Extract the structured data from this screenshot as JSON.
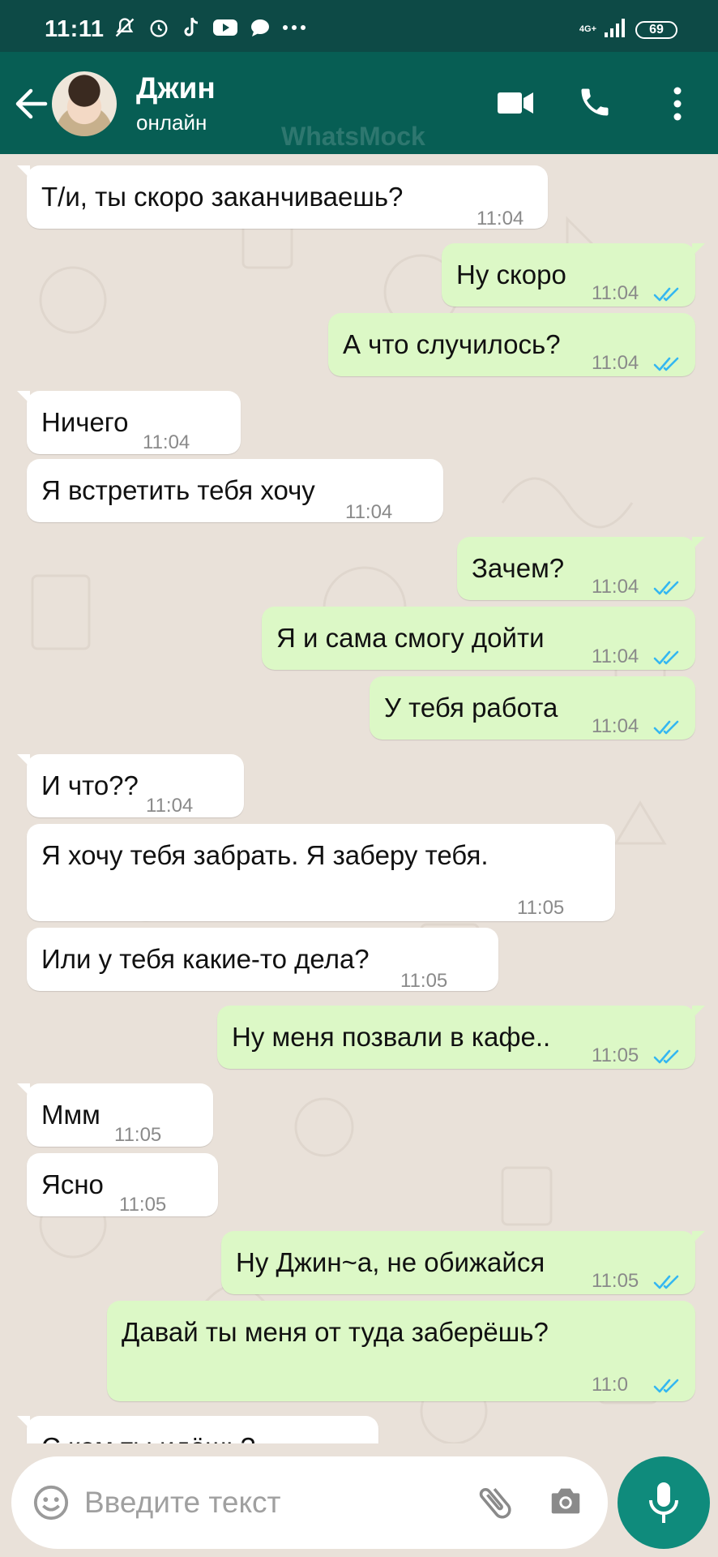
{
  "status_bar": {
    "time": "11:11",
    "network": "4G+",
    "battery": "69"
  },
  "header": {
    "contact_name": "Джин",
    "contact_status": "онлайн",
    "watermark": "WhatsMock"
  },
  "messages": [
    {
      "dir": "in",
      "text": "Т/и, ты скоро заканчиваешь?",
      "time": "11:04"
    },
    {
      "dir": "out",
      "text": "Ну скоро",
      "time": "11:04"
    },
    {
      "dir": "out",
      "text": "А что случилось?",
      "time": "11:04"
    },
    {
      "dir": "in",
      "text": "Ничего",
      "time": "11:04"
    },
    {
      "dir": "in",
      "text": "Я встретить тебя хочу",
      "time": "11:04"
    },
    {
      "dir": "out",
      "text": "Зачем?",
      "time": "11:04"
    },
    {
      "dir": "out",
      "text": "Я и сама смогу дойти",
      "time": "11:04"
    },
    {
      "dir": "out",
      "text": "У тебя работа",
      "time": "11:04"
    },
    {
      "dir": "in",
      "text": "И что??",
      "time": "11:04"
    },
    {
      "dir": "in",
      "text": "Я хочу тебя забрать. Я заберу тебя.",
      "time": "11:05"
    },
    {
      "dir": "in",
      "text": "Или у тебя какие-то дела?",
      "time": "11:05"
    },
    {
      "dir": "out",
      "text": "Ну меня позвали в кафе..",
      "time": "11:05"
    },
    {
      "dir": "in",
      "text": "Ммм",
      "time": "11:05"
    },
    {
      "dir": "in",
      "text": "Ясно",
      "time": "11:05"
    },
    {
      "dir": "out",
      "text": "Ну Джин~а, не обижайся",
      "time": "11:05"
    },
    {
      "dir": "out",
      "text": "Давай ты меня от туда заберёшь?",
      "time": "11:0"
    },
    {
      "dir": "in",
      "text": "С кем ты идёшь?",
      "time": ""
    }
  ],
  "composer": {
    "placeholder": "Введите текст"
  },
  "colors": {
    "header": "#075e54",
    "status_bar": "#0d4a46",
    "outgoing_bubble": "#dcf8c6",
    "incoming_bubble": "#ffffff",
    "read_tick": "#34b7f1",
    "mic_button": "#0f8b7c"
  }
}
